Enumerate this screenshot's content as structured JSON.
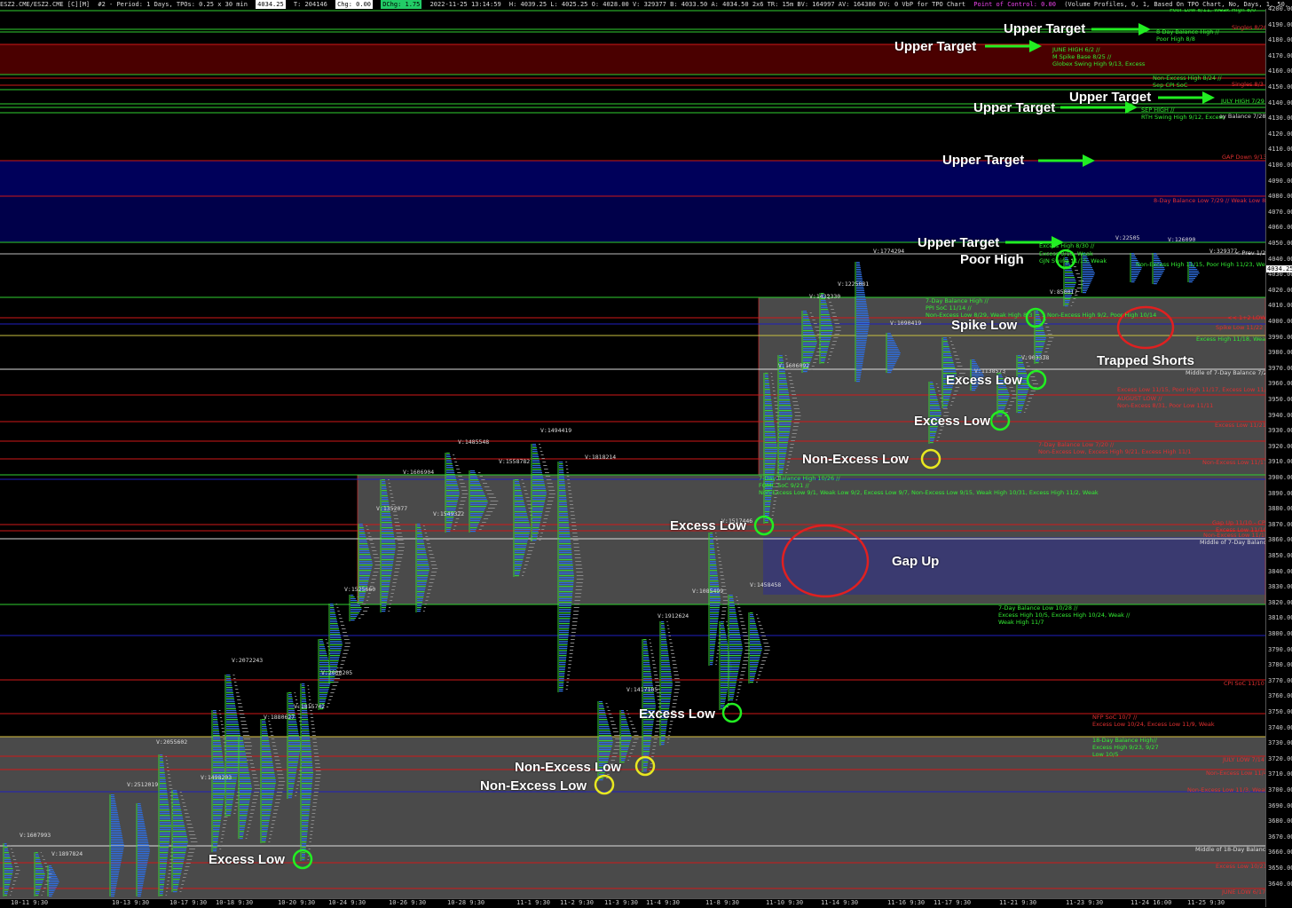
{
  "header": {
    "symbol": "ESZ2.CME/ESZ2.CME [C][M]",
    "period": "#2 - Period: 1 Days, TPOs: 0.25 x 30 min",
    "last_box": "4034.25",
    "trades": "T: 204146",
    "chg": "Chg: 0.00",
    "dchg": "DChg: 1.75",
    "timestamp": "2022-11-25 13:14:59",
    "ohlc": "H: 4039.25 L: 4025.25 O: 4028.00 V: 329377 B: 4033.50 A: 4034.50 2x6 TR: 15m BV: 164997 AV: 164380 DV: 0 VbP for TPO Chart",
    "poc": "Point of Control: 0.00",
    "study": "(Volume Profiles, 0, 1, Based On TPO Chart, No, Days, 1, 50, 1000000, 0, 0, No, 00:00:00, 0, 00:00:00, No, No, Window Width, 70, No, None, 0, No, No, Separ"
  },
  "colors": {
    "green_line": "#2fcf2f",
    "red_line": "#d01818",
    "blue_line": "#2020c0",
    "gray_box": "#4a4a4a",
    "dark_red_zone": "#4a0000",
    "navy_zone": "#00005a",
    "gap_zone": "#3a3a70",
    "profile_blue": "#2e6ee0",
    "profile_green": "#38d038"
  },
  "price_axis": {
    "ticks": [
      "4200.00",
      "4190.00",
      "4180.00",
      "4170.00",
      "4160.00",
      "4150.00",
      "4140.00",
      "4130.00",
      "4120.00",
      "4110.00",
      "4100.00",
      "4090.00",
      "4080.00",
      "4070.00",
      "4060.00",
      "4050.00",
      "4040.00",
      "4030.00",
      "4020.00",
      "4010.00",
      "4000.00",
      "3990.00",
      "3980.00",
      "3970.00",
      "3960.00",
      "3950.00",
      "3940.00",
      "3930.00",
      "3920.00",
      "3910.00",
      "3900.00",
      "3890.00",
      "3880.00",
      "3870.00",
      "3860.00",
      "3850.00",
      "3840.00",
      "3830.00",
      "3820.00",
      "3810.00",
      "3800.00",
      "3790.00",
      "3780.00",
      "3770.00",
      "3760.00",
      "3750.00",
      "3740.00",
      "3730.00",
      "3720.00",
      "3710.00",
      "3700.00",
      "3690.00",
      "3680.00",
      "3670.00",
      "3660.00",
      "3650.00",
      "3640.00"
    ],
    "current": "4034.25"
  },
  "time_axis": [
    "10-11 9:30",
    "10-13 9:30",
    "10-17 9:30",
    "10-18 9:30",
    "10-20 9:30",
    "10-24 9:30",
    "10-26 9:30",
    "10-28 9:30",
    "11-1 9:30",
    "11-2 9:30",
    "11-3 9:30",
    "11-4 9:30",
    "11-8 9:30",
    "11-10 9:30",
    "11-14 9:30",
    "11-16 9:30",
    "11-17 9:30",
    "11-21 9:30",
    "11-23 9:30",
    "11-24 16:00",
    "11-25 9:30"
  ],
  "annotations": {
    "upper_target": "Upper Target",
    "poor_high": "Poor High",
    "spike_low": "Spike Low",
    "trapped_shorts": "Trapped Shorts",
    "excess_low": "Excess Low",
    "non_excess_low": "Non-Excess Low",
    "gap_up": "Gap Up"
  },
  "volume_labels": [
    "V:1607993",
    "V:1897824",
    "V:2512019",
    "V:2055602",
    "V:1498203",
    "V:2072243",
    "V:1880627",
    "V:1815742",
    "V:2000205",
    "V:1525660",
    "V:1352077",
    "V:1606904",
    "V:1549322",
    "V:1485548",
    "V:1558782",
    "V:1494419",
    "V:1818214",
    "V:1417105",
    "V:1912624",
    "V:1085499",
    "V:1517446",
    "V:1458458",
    "V:1606092",
    "V:1432330",
    "V:1225081",
    "V:1774294",
    "V:1090419",
    "V:1138573",
    "V:903338",
    "V:850017",
    "V:22505",
    "V:126090",
    "V:329377"
  ],
  "level_notes": {
    "poor_low_811": "Poor Low 8/11, Weak High 8/0",
    "singles_826": "Singles 8/26",
    "balance_high_88": "8-Day Balance High //",
    "poor_high_88": "Poor High 8/8",
    "june_high": "JUNE HIGH 6/2 //",
    "m_spike_base": "M Spike Base 8/25 //",
    "globex_swing": "Globex Swing High 9/13, Excess",
    "nonexcess_high_824": "Non-Excess High 8/24 //",
    "sep_cpi": "Sep CPI SoC",
    "singles_83": "Singles 8/3",
    "july_high": "JULY HIGH 7/29",
    "sep_high": "SEP HIGH //",
    "rth_swing": "RTH Swing High 9/12, Excess",
    "day_balance_728": "ay Balance 7/28",
    "gap_down_913": "GAP Down 9/13",
    "balance_low_729": "8-Day Balance Low 7/29 // Weak Low 8/2",
    "excess_high_830": "Excess High 8/30 //",
    "excess_913": "Excess 9/13, Weak",
    "gjn": "GJN Swing 11/15, Weak",
    "nonexcess_high_1115": "Non-Excess High 11/15, Poor High 11/23, Weak",
    "prev": "< Prev 1/2",
    "bal_high_7d": "7-Day Balance High //",
    "ppi_soc": "PPI SoC 11/14 //",
    "nonexcess_low_829": "Non-Excess Low 8/29, Weak High 8/3",
    "nonexcess_high_92": "Non-Excess High 9/2, Poor High 10/14",
    "lt_low": "<< 1+2 LOW",
    "spike_low_1122": "Spike Low 11/22",
    "excess_high_1118": "Excess High 11/18, Weak",
    "middle_720": "Middle of 7-Day Balance 7/20",
    "excess_low_1115": "Excess Low 11/15, Poor High 11/17, Excess Low 11/22",
    "august_low": "AUGUST LOW //",
    "nonexcess_831": "Non-Excess 8/31, Poor Low 11/11",
    "excess_low_1121": "Excess Low 11/21",
    "bal_low_720": "7-Day Balance Low 7/20 //",
    "nonexcess_low_921": "Non-Excess Low, Excess High 9/21, Excess High 11/1",
    "nonexcess_low_1117": "Non-Excess Low 11/17",
    "bal_high_1026": "7-Day Balance High 10/26 //",
    "fomc": "FOMC SoC 9/21 //",
    "nonexcess_low_91": "Non-Excess Low 9/1, Weak Low 9/2, Excess Low 9/7, Non-Excess Low 9/15, Weak High 10/31, Excess High 11/2, Weak",
    "gap_up_1110": "Gap Up 11/10 - CPI",
    "excess_low_1110": "Excess Low 11/10",
    "nonexcess_low_1110": "Non-Excess Low 11/10",
    "middle_7day": "Middle of 7-Day Balance",
    "bal_low_1028": "7-Day Balance Low 10/28 //",
    "excess_high_105": "Excess High 10/5, Excess High 10/24, Weak //",
    "weak_high_117": "Weak High 11/7",
    "cpi_soc_1110": "CPI SoC 11/10",
    "nfp_soc": "NFP SoC 10/7 //",
    "excess_low_1024": "Excess Low 10/24, Excess Low 11/9, Weak",
    "bal_high_18": "18-Day Balance High//",
    "excess_high_923": "Excess High 9/23, 9/27",
    "low_105": "Low 10/5",
    "july_low": "JULY LOW 7/14",
    "nonexcess_low_114": "Non-Excess Low 11/4",
    "nonexcess_low_113": "Non-Excess Low 11/3, Weak",
    "middle_18": "Middle of 18-Day Balance",
    "excess_low_1021": "Excess Low 10/21",
    "june_low": "JUNE LOW 6/17"
  }
}
